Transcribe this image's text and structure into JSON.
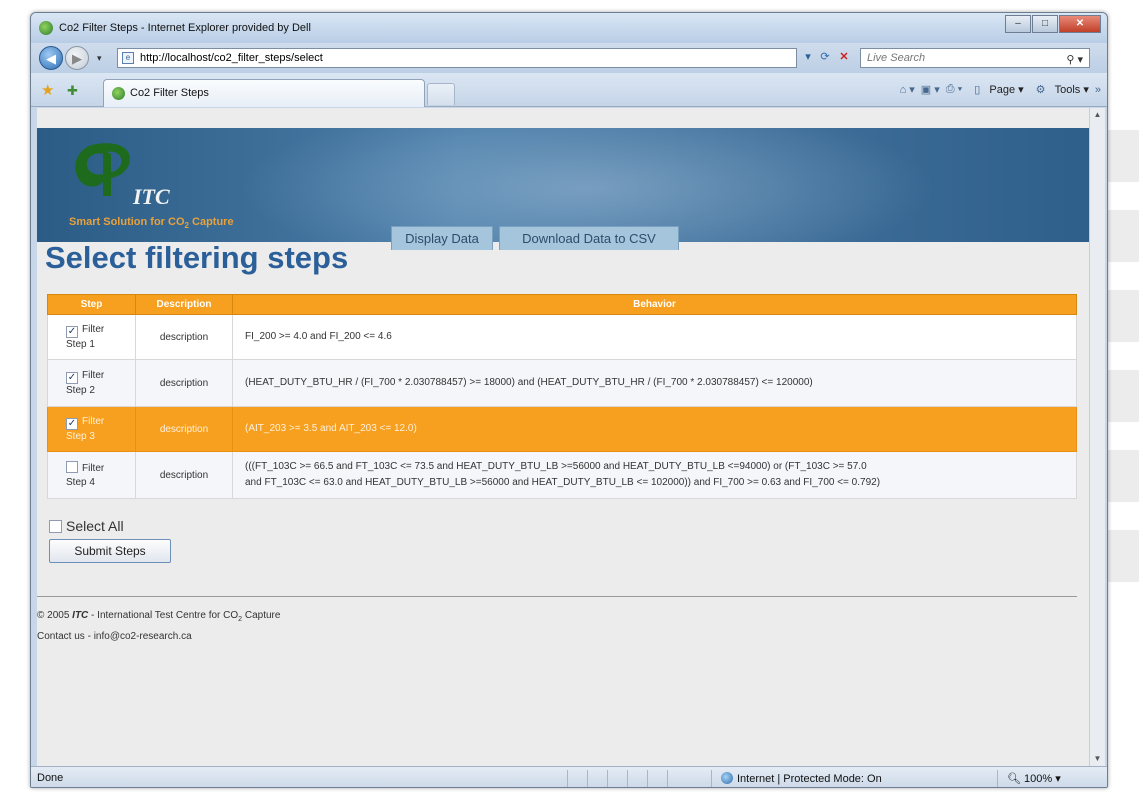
{
  "browser": {
    "window_title": "Co2 Filter Steps - Internet Explorer provided by Dell",
    "url": "http://localhost/co2_filter_steps/select",
    "search_placeholder": "Live Search",
    "tab_title": "Co2 Filter Steps",
    "command_bar": {
      "page": "Page",
      "tools": "Tools"
    },
    "status": {
      "left": "Done",
      "zone": "Internet | Protected Mode: On",
      "zoom": "100%"
    }
  },
  "site": {
    "logo_text": "ITC",
    "tagline_pre": "Smart Solution for CO",
    "tagline_sub": "2",
    "tagline_post": " Capture",
    "nav_tabs": [
      "Display Data",
      "Download Data to CSV"
    ]
  },
  "page_title": "Select filtering steps",
  "table": {
    "headers": [
      "Step",
      "Description",
      "Behavior"
    ],
    "rows": [
      {
        "step_line1": "Filter",
        "step_line2": "Step 1",
        "checked": true,
        "description": "description",
        "behavior": "FI_200 >= 4.0 and FI_200 <= 4.6"
      },
      {
        "step_line1": "Filter",
        "step_line2": "Step 2",
        "checked": true,
        "description": "description",
        "behavior": "(HEAT_DUTY_BTU_HR / (FI_700 * 2.030788457) >= 18000) and (HEAT_DUTY_BTU_HR / (FI_700 * 2.030788457) <= 120000)"
      },
      {
        "step_line1": "Filter",
        "step_line2": "Step 3",
        "checked": true,
        "description": "description",
        "behavior": "(AIT_203 >= 3.5 and AIT_203 <= 12.0)"
      },
      {
        "step_line1": "Filter",
        "step_line2": "Step 4",
        "checked": false,
        "description": "description",
        "behavior_line1": "(((FT_103C >= 66.5 and FT_103C <= 73.5 and HEAT_DUTY_BTU_LB >=56000 and HEAT_DUTY_BTU_LB <=94000) or (FT_103C >= 57.0",
        "behavior_line2": "and FT_103C <= 63.0 and HEAT_DUTY_BTU_LB >=56000 and HEAT_DUTY_BTU_LB <= 102000)) and FI_700 >= 0.63 and FI_700 <= 0.792)"
      }
    ]
  },
  "select_all_label": "Select All",
  "submit_label": "Submit Steps",
  "footer": {
    "copy_pre": "© 2005 ",
    "copy_brand": "ITC",
    "copy_post": " - International Test Centre for CO",
    "copy_sub": "2",
    "copy_end": " Capture",
    "contact": "Contact us - info@co2-research.ca"
  },
  "colors": {
    "header_orange": "#f79f1e",
    "title_blue": "#2a5f99",
    "banner_blue": "#3f6f9a"
  },
  "icons": [
    "back-arrow-icon",
    "forward-arrow-icon",
    "refresh-icon",
    "stop-icon",
    "search-icon",
    "favorites-star-icon",
    "add-favorites-icon",
    "home-icon",
    "feeds-icon",
    "print-icon",
    "page-icon",
    "tools-icon",
    "globe-icon",
    "zoom-icon"
  ]
}
